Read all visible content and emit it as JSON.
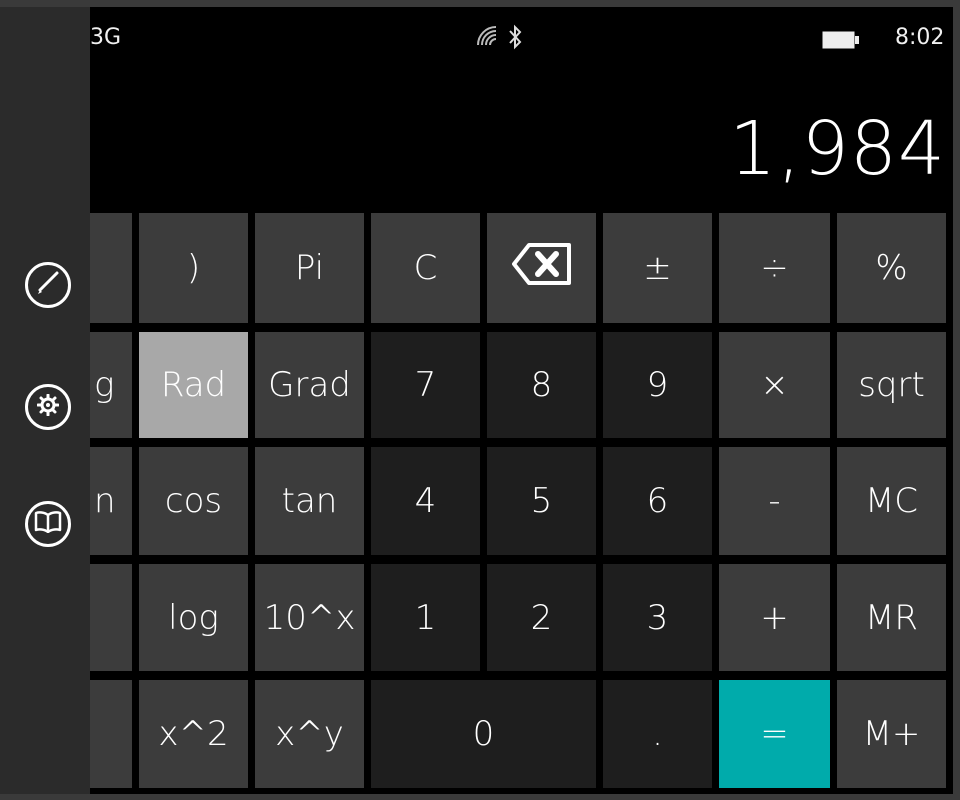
{
  "status": {
    "carrier": "3G",
    "time": "8:02",
    "icons": [
      "wifi-icon",
      "bluetooth-icon",
      "battery-icon"
    ]
  },
  "display": {
    "value": "1,984"
  },
  "sidebar": {
    "items": [
      {
        "name": "pen-icon"
      },
      {
        "name": "settings-gear-icon"
      },
      {
        "name": "book-icon"
      }
    ]
  },
  "keys": {
    "row1": {
      "c1": "",
      "c2": ")",
      "c3": "Pi",
      "c4": "C",
      "c5_icon": "backspace-icon",
      "c6": "±",
      "c7": "÷",
      "c8": "%"
    },
    "row2": {
      "c1": "g",
      "c2": "Rad",
      "c3": "Grad",
      "c4": "7",
      "c5": "8",
      "c6": "9",
      "c7": "×",
      "c8": "sqrt"
    },
    "row3": {
      "c1": "n",
      "c2": "cos",
      "c3": "tan",
      "c4": "4",
      "c5": "5",
      "c6": "6",
      "c7": "-",
      "c8": "MC"
    },
    "row4": {
      "c1": "",
      "c2": "log",
      "c3": "10^x",
      "c4": "1",
      "c5": "2",
      "c6": "3",
      "c7": "+",
      "c8": "MR"
    },
    "row5": {
      "c1": "",
      "c2": "x^2",
      "c3": "x^y",
      "c4": "0",
      "c6": ".",
      "c7": "=",
      "c8": "M+"
    }
  },
  "colors": {
    "background": "#000000",
    "function_key": "#3c3c3c",
    "number_key": "#1e1e1e",
    "selected_key": "#a8a8a8",
    "equals_key": "#00abab"
  }
}
